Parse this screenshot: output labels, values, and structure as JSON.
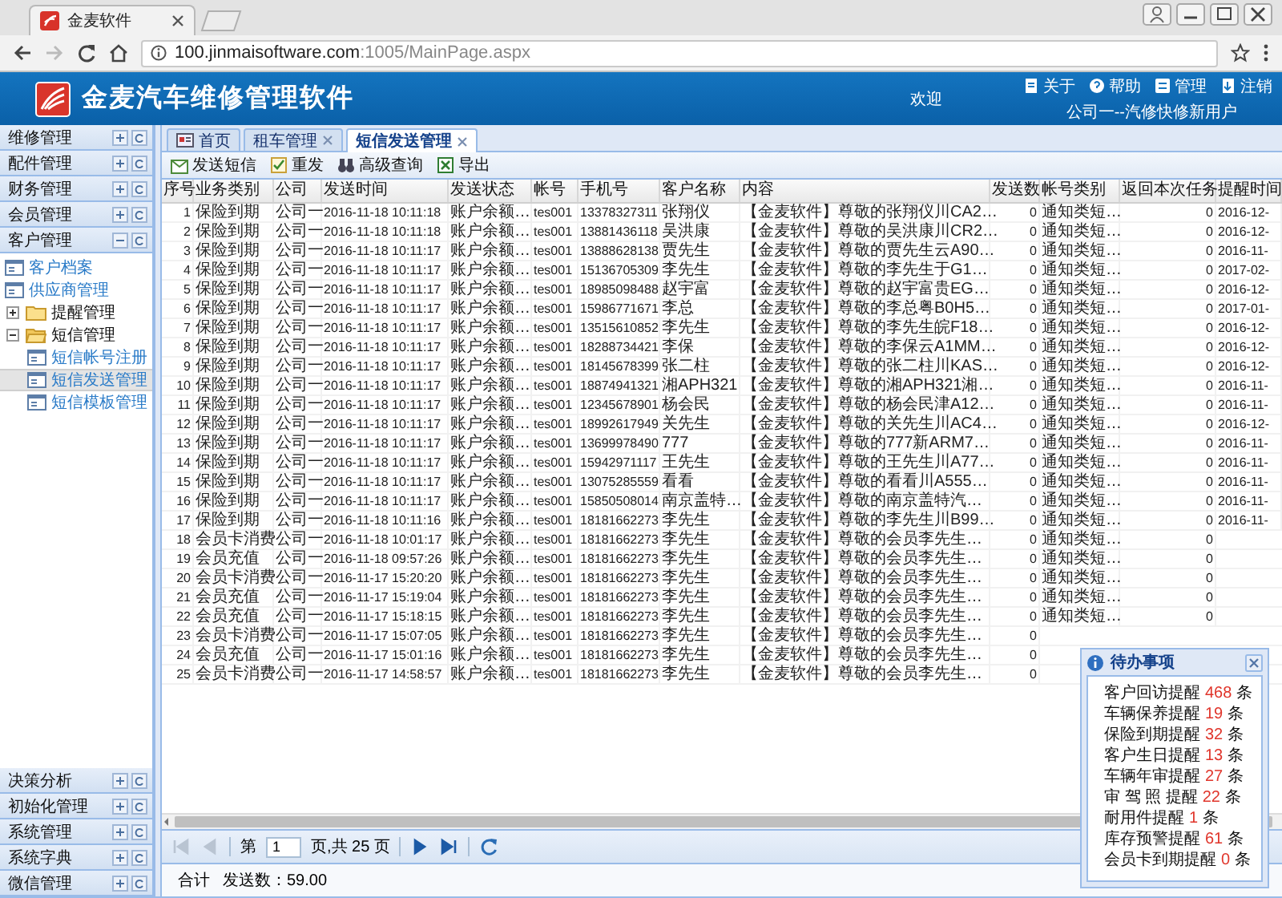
{
  "browser": {
    "tab_title": "金麦软件",
    "url": {
      "host": "100.jinmaisoftware.com",
      "path": ":1005/MainPage.aspx"
    }
  },
  "header": {
    "title": "金麦汽车维修管理软件",
    "welcome": "欢迎",
    "links": [
      "关于",
      "帮助",
      "管理",
      "注销"
    ],
    "user": "公司一--汽修快修新用户"
  },
  "sidebar": {
    "sections": [
      {
        "label": "维修管理",
        "expanded": false
      },
      {
        "label": "配件管理",
        "expanded": false
      },
      {
        "label": "财务管理",
        "expanded": false
      },
      {
        "label": "会员管理",
        "expanded": false
      },
      {
        "label": "客户管理",
        "expanded": true,
        "items": [
          {
            "label": "客户档案",
            "kind": "leaf",
            "selected": false
          },
          {
            "label": "供应商管理",
            "kind": "leaf",
            "selected": false
          },
          {
            "label": "提醒管理",
            "kind": "folder",
            "expanded": false,
            "selected": false
          },
          {
            "label": "短信管理",
            "kind": "folder",
            "expanded": true,
            "selected": false,
            "children": [
              {
                "label": "短信帐号注册",
                "kind": "leaf",
                "selected": false
              },
              {
                "label": "短信发送管理",
                "kind": "leaf",
                "selected": true
              },
              {
                "label": "短信模板管理",
                "kind": "leaf",
                "selected": false
              }
            ]
          }
        ]
      },
      {
        "label": "决策分析",
        "expanded": false
      },
      {
        "label": "初始化管理",
        "expanded": false
      },
      {
        "label": "系统管理",
        "expanded": false
      },
      {
        "label": "系统字典",
        "expanded": false
      },
      {
        "label": "微信管理",
        "expanded": false
      }
    ]
  },
  "main_tabs": [
    {
      "label": "首页",
      "kind": "home",
      "selected": false
    },
    {
      "label": "租车管理",
      "kind": "page",
      "selected": false
    },
    {
      "label": "短信发送管理",
      "kind": "page",
      "selected": true
    }
  ],
  "toolbar": [
    "发送短信",
    "重发",
    "高级查询",
    "导出"
  ],
  "table": {
    "columns": [
      "序号",
      "业务类别",
      "公司",
      "发送时间",
      "发送状态",
      "帐号",
      "手机号",
      "客户名称",
      "内容",
      "发送数",
      "帐号类别",
      "返回本次任务",
      "提醒时间"
    ],
    "rows": [
      [
        "1",
        "保险到期",
        "公司一",
        "2016-11-18 10:11:18",
        "账户余额…",
        "tes001",
        "13378327311",
        "张翔仪",
        "【金麦软件】尊敬的张翔仪川CA2…",
        "0",
        "通知类短…",
        "0",
        "2016-12-"
      ],
      [
        "2",
        "保险到期",
        "公司一",
        "2016-11-18 10:11:18",
        "账户余额…",
        "tes001",
        "13881436118",
        "吴洪康",
        "【金麦软件】尊敬的吴洪康川CR2…",
        "0",
        "通知类短…",
        "0",
        "2016-12-"
      ],
      [
        "3",
        "保险到期",
        "公司一",
        "2016-11-18 10:11:17",
        "账户余额…",
        "tes001",
        "13888628138",
        "贾先生",
        "【金麦软件】尊敬的贾先生云A90…",
        "0",
        "通知类短…",
        "0",
        "2016-11-"
      ],
      [
        "4",
        "保险到期",
        "公司一",
        "2016-11-18 10:11:17",
        "账户余额…",
        "tes001",
        "15136705309",
        "李先生",
        "【金麦软件】尊敬的李先生于G1…",
        "0",
        "通知类短…",
        "0",
        "2017-02-"
      ],
      [
        "5",
        "保险到期",
        "公司一",
        "2016-11-18 10:11:17",
        "账户余额…",
        "tes001",
        "18985098488",
        "赵宇富",
        "【金麦软件】尊敬的赵宇富贵EG…",
        "0",
        "通知类短…",
        "0",
        "2016-12-"
      ],
      [
        "6",
        "保险到期",
        "公司一",
        "2016-11-18 10:11:17",
        "账户余额…",
        "tes001",
        "15986771671",
        "李总",
        "【金麦软件】尊敬的李总粤B0H5…",
        "0",
        "通知类短…",
        "0",
        "2017-01-"
      ],
      [
        "7",
        "保险到期",
        "公司一",
        "2016-11-18 10:11:17",
        "账户余额…",
        "tes001",
        "13515610852",
        "李先生",
        "【金麦软件】尊敬的李先生皖F18…",
        "0",
        "通知类短…",
        "0",
        "2016-12-"
      ],
      [
        "8",
        "保险到期",
        "公司一",
        "2016-11-18 10:11:17",
        "账户余额…",
        "tes001",
        "18288734421",
        "李保",
        "【金麦软件】尊敬的李保云A1MM…",
        "0",
        "通知类短…",
        "0",
        "2016-12-"
      ],
      [
        "9",
        "保险到期",
        "公司一",
        "2016-11-18 10:11:17",
        "账户余额…",
        "tes001",
        "18145678399",
        "张二柱",
        "【金麦软件】尊敬的张二柱川KAS…",
        "0",
        "通知类短…",
        "0",
        "2016-12-"
      ],
      [
        "10",
        "保险到期",
        "公司一",
        "2016-11-18 10:11:17",
        "账户余额…",
        "tes001",
        "18874941321",
        "湘APH321",
        "【金麦软件】尊敬的湘APH321湘…",
        "0",
        "通知类短…",
        "0",
        "2016-11-"
      ],
      [
        "11",
        "保险到期",
        "公司一",
        "2016-11-18 10:11:17",
        "账户余额…",
        "tes001",
        "12345678901",
        "杨会民",
        "【金麦软件】尊敬的杨会民津A12…",
        "0",
        "通知类短…",
        "0",
        "2016-11-"
      ],
      [
        "12",
        "保险到期",
        "公司一",
        "2016-11-18 10:11:17",
        "账户余额…",
        "tes001",
        "18992617949",
        "关先生",
        "【金麦软件】尊敬的关先生川AC4…",
        "0",
        "通知类短…",
        "0",
        "2016-12-"
      ],
      [
        "13",
        "保险到期",
        "公司一",
        "2016-11-18 10:11:17",
        "账户余额…",
        "tes001",
        "13699978490",
        "777",
        "【金麦软件】尊敬的777新ARM7…",
        "0",
        "通知类短…",
        "0",
        "2016-11-"
      ],
      [
        "14",
        "保险到期",
        "公司一",
        "2016-11-18 10:11:17",
        "账户余额…",
        "tes001",
        "15942971117",
        "王先生",
        "【金麦软件】尊敬的王先生川A77…",
        "0",
        "通知类短…",
        "0",
        "2016-11-"
      ],
      [
        "15",
        "保险到期",
        "公司一",
        "2016-11-18 10:11:17",
        "账户余额…",
        "tes001",
        "13075285559",
        "看看",
        "【金麦软件】尊敬的看看川A555…",
        "0",
        "通知类短…",
        "0",
        "2016-11-"
      ],
      [
        "16",
        "保险到期",
        "公司一",
        "2016-11-18 10:11:17",
        "账户余额…",
        "tes001",
        "15850508014",
        "南京盖特…",
        "【金麦软件】尊敬的南京盖特汽…",
        "0",
        "通知类短…",
        "0",
        "2016-11-"
      ],
      [
        "17",
        "保险到期",
        "公司一",
        "2016-11-18 10:11:16",
        "账户余额…",
        "tes001",
        "18181662273",
        "李先生",
        "【金麦软件】尊敬的李先生川B99…",
        "0",
        "通知类短…",
        "0",
        "2016-11-"
      ],
      [
        "18",
        "会员卡消费",
        "公司一",
        "2016-11-18 10:01:17",
        "账户余额…",
        "tes001",
        "18181662273",
        "李先生",
        "【金麦软件】尊敬的会员李先生…",
        "0",
        "通知类短…",
        "0"
      ],
      [
        "19",
        "会员充值",
        "公司一",
        "2016-11-18 09:57:26",
        "账户余额…",
        "tes001",
        "18181662273",
        "李先生",
        "【金麦软件】尊敬的会员李先生…",
        "0",
        "通知类短…",
        "0"
      ],
      [
        "20",
        "会员卡消费",
        "公司一",
        "2016-11-17 15:20:20",
        "账户余额…",
        "tes001",
        "18181662273",
        "李先生",
        "【金麦软件】尊敬的会员李先生…",
        "0",
        "通知类短…",
        "0"
      ],
      [
        "21",
        "会员充值",
        "公司一",
        "2016-11-17 15:19:04",
        "账户余额…",
        "tes001",
        "18181662273",
        "李先生",
        "【金麦软件】尊敬的会员李先生…",
        "0",
        "通知类短…",
        "0"
      ],
      [
        "22",
        "会员充值",
        "公司一",
        "2016-11-17 15:18:15",
        "账户余额…",
        "tes001",
        "18181662273",
        "李先生",
        "【金麦软件】尊敬的会员李先生…",
        "0",
        "通知类短…",
        "0"
      ],
      [
        "23",
        "会员卡消费",
        "公司一",
        "2016-11-17 15:07:05",
        "账户余额…",
        "tes001",
        "18181662273",
        "李先生",
        "【金麦软件】尊敬的会员李先生…",
        "0"
      ],
      [
        "24",
        "会员充值",
        "公司一",
        "2016-11-17 15:01:16",
        "账户余额…",
        "tes001",
        "18181662273",
        "李先生",
        "【金麦软件】尊敬的会员李先生…",
        "0"
      ],
      [
        "25",
        "会员卡消费",
        "公司一",
        "2016-11-17 14:58:57",
        "账户余额…",
        "tes001",
        "18181662273",
        "李先生",
        "【金麦软件】尊敬的会员李先生…",
        "0"
      ]
    ]
  },
  "pager": {
    "nav_buttons": [
      {
        "disabled": true
      },
      {
        "disabled": true
      },
      {
        "disabled": false
      },
      {
        "disabled": false
      }
    ],
    "before": "第",
    "page": "1",
    "after": "页,共 25 页"
  },
  "summary": {
    "label": "合计",
    "value": "发送数：59.00"
  },
  "todo": {
    "title": "待办事项",
    "items": [
      {
        "label": "客户回访提醒",
        "count": "468",
        "unit": "条"
      },
      {
        "label": "车辆保养提醒",
        "count": "19",
        "unit": "条"
      },
      {
        "label": "保险到期提醒",
        "count": "32",
        "unit": "条"
      },
      {
        "label": "客户生日提醒",
        "count": "13",
        "unit": "条"
      },
      {
        "label": "车辆年审提醒",
        "count": "27",
        "unit": "条"
      },
      {
        "label": "审 驾 照 提醒",
        "count": "22",
        "unit": "条"
      },
      {
        "label": "耐用件提醒",
        "count": "1",
        "unit": "条"
      },
      {
        "label": "库存预警提醒",
        "count": "61",
        "unit": "条"
      },
      {
        "label": "会员卡到期提醒",
        "count": "0",
        "unit": "条"
      }
    ]
  }
}
